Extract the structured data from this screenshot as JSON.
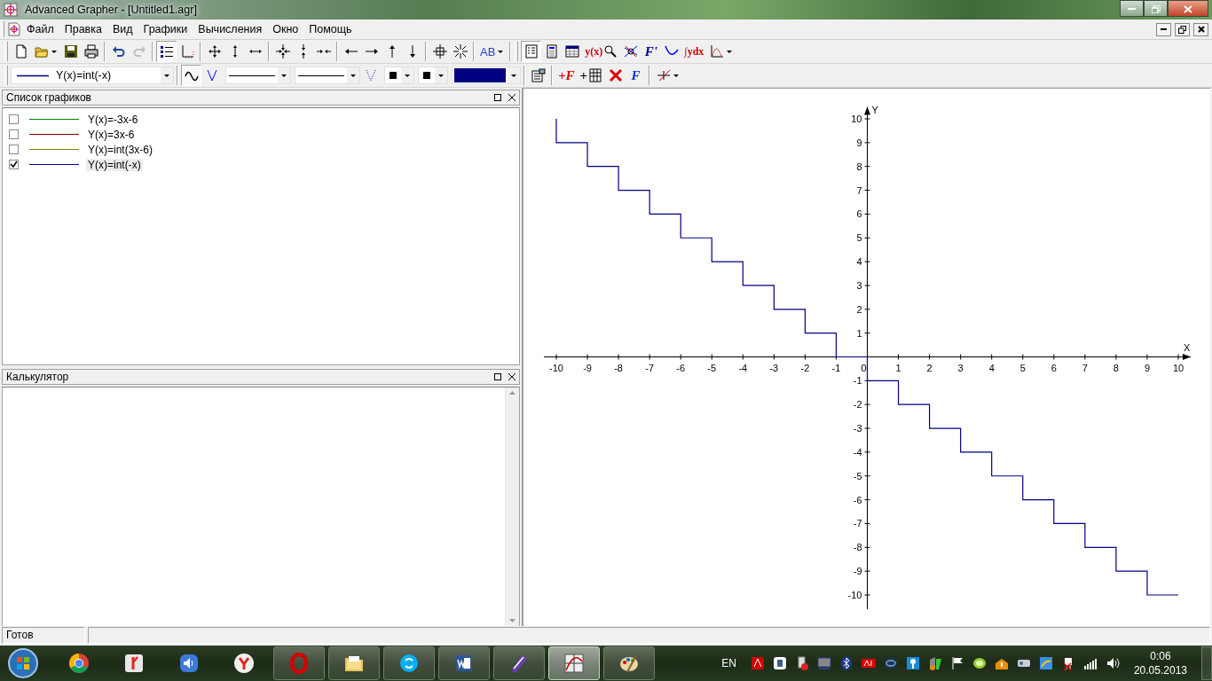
{
  "window": {
    "title": "Advanced Grapher - [Untitled1.agr]"
  },
  "menu": [
    "Файл",
    "Правка",
    "Вид",
    "Графики",
    "Вычисления",
    "Окно",
    "Помощь"
  ],
  "toolbars": [
    {
      "items": [
        {
          "kind": "grip"
        },
        {
          "kind": "new",
          "pressed": false,
          "disabled": false
        },
        {
          "kind": "open",
          "pressed": false,
          "disabled": false,
          "menu": true
        },
        {
          "kind": "save",
          "pressed": false,
          "disabled": false
        },
        {
          "kind": "print",
          "pressed": false,
          "disabled": false
        },
        {
          "kind": "separator"
        },
        {
          "kind": "undo",
          "pressed": false,
          "disabled": false
        },
        {
          "kind": "redo",
          "pressed": false,
          "disabled": true
        },
        {
          "kind": "separator"
        },
        {
          "kind": "list",
          "pressed": true,
          "disabled": false
        },
        {
          "kind": "axes",
          "pressed": false,
          "disabled": false
        },
        {
          "kind": "separator"
        },
        {
          "kind": "move-all",
          "pressed": false,
          "disabled": false
        },
        {
          "kind": "move-v",
          "pressed": false,
          "disabled": false
        },
        {
          "kind": "move-h",
          "pressed": false,
          "disabled": false
        },
        {
          "kind": "separator"
        },
        {
          "kind": "zoom-all",
          "pressed": false,
          "disabled": false
        },
        {
          "kind": "zoom-v",
          "pressed": false,
          "disabled": false
        },
        {
          "kind": "zoom-h",
          "pressed": false,
          "disabled": false
        },
        {
          "kind": "separator"
        },
        {
          "kind": "left",
          "pressed": false,
          "disabled": false
        },
        {
          "kind": "right",
          "pressed": false,
          "disabled": false
        },
        {
          "kind": "up",
          "pressed": false,
          "disabled": false
        },
        {
          "kind": "down",
          "pressed": false,
          "disabled": false
        },
        {
          "kind": "separator"
        },
        {
          "kind": "grid",
          "pressed": false,
          "disabled": false
        },
        {
          "kind": "unzoom",
          "pressed": false,
          "disabled": false
        },
        {
          "kind": "separator"
        },
        {
          "kind": "text-style",
          "label": "AB",
          "pressed": false,
          "disabled": false,
          "menu": true
        },
        {
          "kind": "separator"
        },
        {
          "kind": "grip"
        },
        {
          "kind": "graph-list",
          "pressed": true,
          "disabled": false
        },
        {
          "kind": "calculator",
          "pressed": false,
          "disabled": false
        },
        {
          "kind": "table",
          "pressed": false,
          "disabled": false
        },
        {
          "kind": "evaluate",
          "label": "y(x)",
          "pressed": false,
          "disabled": false
        },
        {
          "kind": "intersect",
          "pressed": false,
          "disabled": false
        },
        {
          "kind": "derivative",
          "label": "F'",
          "pressed": false,
          "disabled": false
        },
        {
          "kind": "extremum",
          "pressed": false,
          "disabled": false
        },
        {
          "kind": "integral",
          "label": "∫ydx",
          "pressed": false,
          "disabled": false
        },
        {
          "kind": "chart",
          "pressed": false,
          "disabled": false,
          "menu": true
        }
      ]
    },
    {
      "items": [
        {
          "kind": "grip"
        },
        {
          "kind": "function-select",
          "value": "Y(x)=int(-x)",
          "color": "#000080"
        },
        {
          "kind": "separator"
        },
        {
          "kind": "curve",
          "pressed": true,
          "disabled": false
        },
        {
          "kind": "points",
          "pressed": false,
          "disabled": false
        },
        {
          "kind": "line-select"
        },
        {
          "kind": "line-select"
        },
        {
          "kind": "marker",
          "pressed": false,
          "disabled": false
        },
        {
          "kind": "marker-select"
        },
        {
          "kind": "marker-select"
        },
        {
          "kind": "color-select",
          "color": "#000080"
        },
        {
          "kind": "separator"
        },
        {
          "kind": "properties",
          "pressed": false,
          "disabled": false
        },
        {
          "kind": "separator"
        },
        {
          "kind": "add-function",
          "label": "+F",
          "pressed": false,
          "disabled": false
        },
        {
          "kind": "add-table",
          "label": "+",
          "pressed": false,
          "disabled": false
        },
        {
          "kind": "delete",
          "pressed": false,
          "disabled": false
        },
        {
          "kind": "edit-function",
          "label": "F",
          "pressed": false,
          "disabled": false
        },
        {
          "kind": "separator"
        },
        {
          "kind": "intersection",
          "pressed": false,
          "disabled": false,
          "menu": true
        }
      ]
    }
  ],
  "graph_list": {
    "title": "Список графиков",
    "items": [
      {
        "label": "Y(x)=-3x-6",
        "color": "#008000",
        "checked": false,
        "selected": false
      },
      {
        "label": "Y(x)=3x-6",
        "color": "#800000",
        "checked": false,
        "selected": false
      },
      {
        "label": "Y(x)=int(3x-6)",
        "color": "#808000",
        "checked": false,
        "selected": false
      },
      {
        "label": "Y(x)=int(-x)",
        "color": "#000080",
        "checked": true,
        "selected": true
      }
    ]
  },
  "calculator": {
    "title": "Калькулятор"
  },
  "graph": {
    "chart_data": {
      "type": "line",
      "xlabel": "X",
      "ylabel": "Y",
      "x": [
        -10,
        -10,
        -9,
        -9,
        -8,
        -8,
        -7,
        -7,
        -6,
        -6,
        -5,
        -5,
        -4,
        -4,
        -3,
        -3,
        -2,
        -2,
        -1,
        -1,
        0,
        0,
        1,
        1,
        2,
        2,
        3,
        3,
        4,
        4,
        5,
        5,
        6,
        6,
        7,
        7,
        8,
        8,
        9,
        9,
        10
      ],
      "xlim": [
        -10.4,
        10.4
      ],
      "ylim": [
        -10.6,
        10.5
      ],
      "series": [
        {
          "color": "#000080",
          "values": [
            10,
            9,
            9,
            8,
            8,
            7,
            7,
            6,
            6,
            5,
            5,
            4,
            4,
            3,
            3,
            2,
            2,
            1,
            1,
            0,
            0,
            -1,
            -1,
            -2,
            -2,
            -3,
            -3,
            -4,
            -4,
            -5,
            -5,
            -6,
            -6,
            -7,
            -7,
            -8,
            -8,
            -9,
            -9,
            -10,
            -10
          ]
        }
      ],
      "xticks": [
        -10,
        -9,
        -8,
        -7,
        -6,
        -5,
        -4,
        -3,
        -2,
        -1,
        0,
        1,
        2,
        3,
        4,
        5,
        6,
        7,
        8,
        9,
        10
      ],
      "yticks": [
        -10,
        -9,
        -8,
        -7,
        -6,
        -5,
        -4,
        -3,
        -2,
        -1,
        1,
        2,
        3,
        4,
        5,
        6,
        7,
        8,
        9,
        10
      ]
    }
  },
  "status_bar": {
    "text": "Готов"
  },
  "taskbar": {
    "apps": [
      {
        "kind": "chrome",
        "running": false,
        "active": false
      },
      {
        "kind": "yandex",
        "running": false,
        "active": false
      },
      {
        "kind": "media",
        "running": false,
        "active": false
      },
      {
        "kind": "ybrowser",
        "running": false,
        "active": false
      },
      {
        "kind": "opera",
        "running": true,
        "active": false
      },
      {
        "kind": "explorer",
        "running": true,
        "active": false
      },
      {
        "kind": "skype",
        "running": true,
        "active": false
      },
      {
        "kind": "word",
        "running": true,
        "active": false
      },
      {
        "kind": "pen",
        "running": true,
        "active": false
      },
      {
        "kind": "grapher",
        "running": true,
        "active": true
      },
      {
        "kind": "paint",
        "running": true,
        "active": false
      }
    ],
    "language": "EN",
    "time": "0:06",
    "date": "20.05.2013"
  }
}
